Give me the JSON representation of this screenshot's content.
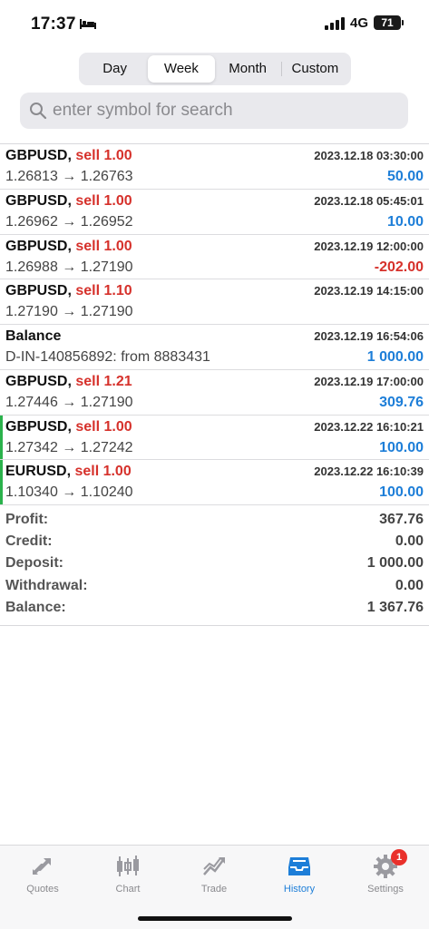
{
  "status_bar": {
    "time": "17:37",
    "network": "4G",
    "battery": "71"
  },
  "period_tabs": [
    "Day",
    "Week",
    "Month",
    "Custom"
  ],
  "search": {
    "placeholder": "enter symbol for search",
    "value": ""
  },
  "history": [
    {
      "symbol": "GBPUSD",
      "side": "sell 1.00",
      "date": "2023.12.18 03:30:00",
      "prices": "1.26813 → 1.26763",
      "value": "50.00",
      "sign": "pos"
    },
    {
      "symbol": "GBPUSD",
      "side": "sell 1.00",
      "date": "2023.12.18 05:45:01",
      "prices": "1.26962 → 1.26952",
      "value": "10.00",
      "sign": "pos"
    },
    {
      "symbol": "GBPUSD",
      "side": "sell 1.00",
      "date": "2023.12.19 12:00:00",
      "prices": "1.26988 → 1.27190",
      "value": "-202.00",
      "sign": "neg"
    },
    {
      "symbol": "GBPUSD",
      "side": "sell 1.10",
      "date": "2023.12.19 14:15:00",
      "prices": "1.27190 → 1.27190",
      "value": "",
      "sign": "pos"
    },
    {
      "symbol": "Balance",
      "side": "",
      "date": "2023.12.19 16:54:06",
      "prices": "D-IN-140856892: from 8883431",
      "value": "1 000.00",
      "sign": "pos"
    },
    {
      "symbol": "GBPUSD",
      "side": "sell 1.21",
      "date": "2023.12.19 17:00:00",
      "prices": "1.27446 → 1.27190",
      "value": "309.76",
      "sign": "pos"
    },
    {
      "symbol": "GBPUSD",
      "side": "sell 1.00",
      "date": "2023.12.22 16:10:21",
      "prices": "1.27342 → 1.27242",
      "value": "100.00",
      "sign": "pos",
      "marked": true
    },
    {
      "symbol": "EURUSD",
      "side": "sell 1.00",
      "date": "2023.12.22 16:10:39",
      "prices": "1.10340 → 1.10240",
      "value": "100.00",
      "sign": "pos",
      "marked": true
    }
  ],
  "summary": [
    {
      "label": "Profit:",
      "value": "367.76"
    },
    {
      "label": "Credit:",
      "value": "0.00"
    },
    {
      "label": "Deposit:",
      "value": "1 000.00"
    },
    {
      "label": "Withdrawal:",
      "value": "0.00"
    },
    {
      "label": "Balance:",
      "value": "1 367.76"
    }
  ],
  "tabbar": [
    {
      "label": "Quotes",
      "icon": "quotes-icon"
    },
    {
      "label": "Chart",
      "icon": "chart-icon"
    },
    {
      "label": "Trade",
      "icon": "trade-icon"
    },
    {
      "label": "History",
      "icon": "history-icon",
      "active": true
    },
    {
      "label": "Settings",
      "icon": "settings-icon",
      "badge": "1"
    }
  ],
  "colors": {
    "accent": "#1d7ed8",
    "negative": "#d6312b",
    "marker": "#2bb24c"
  }
}
